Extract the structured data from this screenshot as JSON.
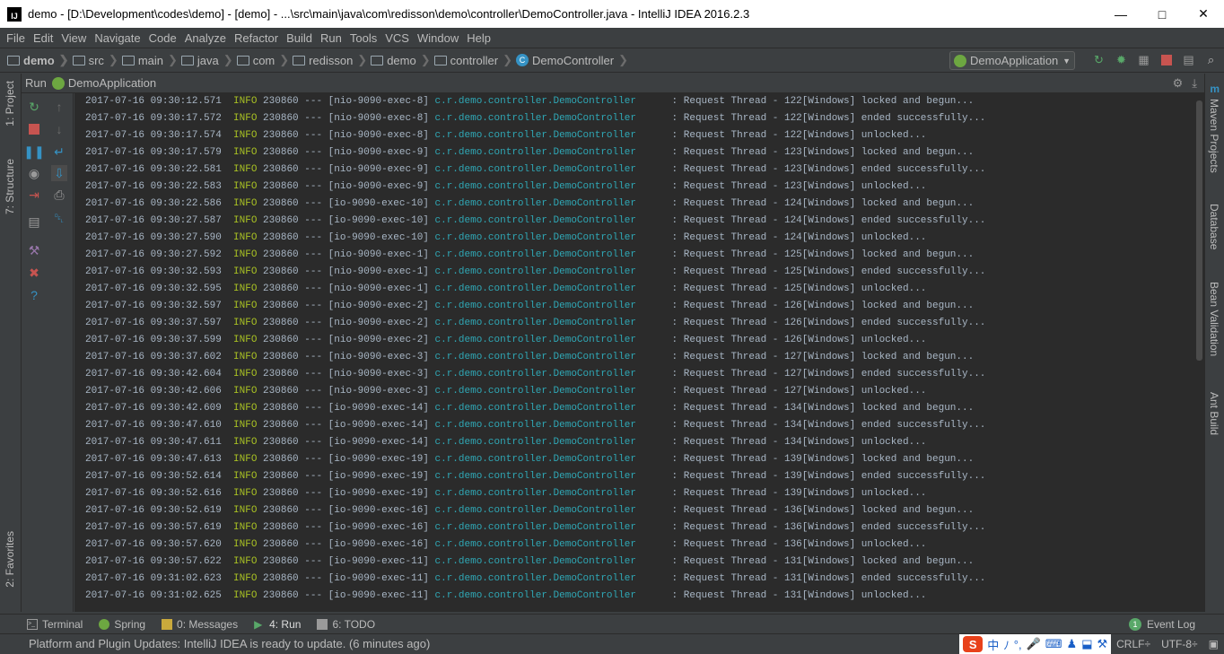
{
  "window": {
    "title": "demo - [D:\\Development\\codes\\demo] - [demo] - ...\\src\\main\\java\\com\\redisson\\demo\\controller\\DemoController.java - IntelliJ IDEA 2016.2.3",
    "logo": "IJ"
  },
  "menu": [
    "File",
    "Edit",
    "View",
    "Navigate",
    "Code",
    "Analyze",
    "Refactor",
    "Build",
    "Run",
    "Tools",
    "VCS",
    "Window",
    "Help"
  ],
  "breadcrumb": [
    "demo",
    "src",
    "main",
    "java",
    "com",
    "redisson",
    "demo",
    "controller",
    "DemoController"
  ],
  "run_config": "DemoApplication",
  "run_panel": {
    "label": "Run",
    "config": "DemoApplication"
  },
  "left_tabs": {
    "project": "1: Project",
    "structure": "7: Structure",
    "favorites": "2: Favorites"
  },
  "right_tabs": {
    "maven": "Maven Projects",
    "database": "Database",
    "bean": "Bean Validation",
    "ant": "Ant Build"
  },
  "log_lines": [
    {
      "time": "2017-07-16 09:30:12.571",
      "level": "INFO",
      "pid": "230860",
      "thread": "[nio-9090-exec-8]",
      "logger": "c.r.demo.controller.DemoController",
      "msg": ": Request Thread - 122[Windows] locked and begun..."
    },
    {
      "time": "2017-07-16 09:30:17.572",
      "level": "INFO",
      "pid": "230860",
      "thread": "[nio-9090-exec-8]",
      "logger": "c.r.demo.controller.DemoController",
      "msg": ": Request Thread - 122[Windows] ended successfully..."
    },
    {
      "time": "2017-07-16 09:30:17.574",
      "level": "INFO",
      "pid": "230860",
      "thread": "[nio-9090-exec-8]",
      "logger": "c.r.demo.controller.DemoController",
      "msg": ": Request Thread - 122[Windows] unlocked..."
    },
    {
      "time": "2017-07-16 09:30:17.579",
      "level": "INFO",
      "pid": "230860",
      "thread": "[nio-9090-exec-9]",
      "logger": "c.r.demo.controller.DemoController",
      "msg": ": Request Thread - 123[Windows] locked and begun..."
    },
    {
      "time": "2017-07-16 09:30:22.581",
      "level": "INFO",
      "pid": "230860",
      "thread": "[nio-9090-exec-9]",
      "logger": "c.r.demo.controller.DemoController",
      "msg": ": Request Thread - 123[Windows] ended successfully..."
    },
    {
      "time": "2017-07-16 09:30:22.583",
      "level": "INFO",
      "pid": "230860",
      "thread": "[nio-9090-exec-9]",
      "logger": "c.r.demo.controller.DemoController",
      "msg": ": Request Thread - 123[Windows] unlocked..."
    },
    {
      "time": "2017-07-16 09:30:22.586",
      "level": "INFO",
      "pid": "230860",
      "thread": "[io-9090-exec-10]",
      "logger": "c.r.demo.controller.DemoController",
      "msg": ": Request Thread - 124[Windows] locked and begun..."
    },
    {
      "time": "2017-07-16 09:30:27.587",
      "level": "INFO",
      "pid": "230860",
      "thread": "[io-9090-exec-10]",
      "logger": "c.r.demo.controller.DemoController",
      "msg": ": Request Thread - 124[Windows] ended successfully..."
    },
    {
      "time": "2017-07-16 09:30:27.590",
      "level": "INFO",
      "pid": "230860",
      "thread": "[io-9090-exec-10]",
      "logger": "c.r.demo.controller.DemoController",
      "msg": ": Request Thread - 124[Windows] unlocked..."
    },
    {
      "time": "2017-07-16 09:30:27.592",
      "level": "INFO",
      "pid": "230860",
      "thread": "[nio-9090-exec-1]",
      "logger": "c.r.demo.controller.DemoController",
      "msg": ": Request Thread - 125[Windows] locked and begun..."
    },
    {
      "time": "2017-07-16 09:30:32.593",
      "level": "INFO",
      "pid": "230860",
      "thread": "[nio-9090-exec-1]",
      "logger": "c.r.demo.controller.DemoController",
      "msg": ": Request Thread - 125[Windows] ended successfully..."
    },
    {
      "time": "2017-07-16 09:30:32.595",
      "level": "INFO",
      "pid": "230860",
      "thread": "[nio-9090-exec-1]",
      "logger": "c.r.demo.controller.DemoController",
      "msg": ": Request Thread - 125[Windows] unlocked..."
    },
    {
      "time": "2017-07-16 09:30:32.597",
      "level": "INFO",
      "pid": "230860",
      "thread": "[nio-9090-exec-2]",
      "logger": "c.r.demo.controller.DemoController",
      "msg": ": Request Thread - 126[Windows] locked and begun..."
    },
    {
      "time": "2017-07-16 09:30:37.597",
      "level": "INFO",
      "pid": "230860",
      "thread": "[nio-9090-exec-2]",
      "logger": "c.r.demo.controller.DemoController",
      "msg": ": Request Thread - 126[Windows] ended successfully..."
    },
    {
      "time": "2017-07-16 09:30:37.599",
      "level": "INFO",
      "pid": "230860",
      "thread": "[nio-9090-exec-2]",
      "logger": "c.r.demo.controller.DemoController",
      "msg": ": Request Thread - 126[Windows] unlocked..."
    },
    {
      "time": "2017-07-16 09:30:37.602",
      "level": "INFO",
      "pid": "230860",
      "thread": "[nio-9090-exec-3]",
      "logger": "c.r.demo.controller.DemoController",
      "msg": ": Request Thread - 127[Windows] locked and begun..."
    },
    {
      "time": "2017-07-16 09:30:42.604",
      "level": "INFO",
      "pid": "230860",
      "thread": "[nio-9090-exec-3]",
      "logger": "c.r.demo.controller.DemoController",
      "msg": ": Request Thread - 127[Windows] ended successfully..."
    },
    {
      "time": "2017-07-16 09:30:42.606",
      "level": "INFO",
      "pid": "230860",
      "thread": "[nio-9090-exec-3]",
      "logger": "c.r.demo.controller.DemoController",
      "msg": ": Request Thread - 127[Windows] unlocked..."
    },
    {
      "time": "2017-07-16 09:30:42.609",
      "level": "INFO",
      "pid": "230860",
      "thread": "[io-9090-exec-14]",
      "logger": "c.r.demo.controller.DemoController",
      "msg": ": Request Thread - 134[Windows] locked and begun..."
    },
    {
      "time": "2017-07-16 09:30:47.610",
      "level": "INFO",
      "pid": "230860",
      "thread": "[io-9090-exec-14]",
      "logger": "c.r.demo.controller.DemoController",
      "msg": ": Request Thread - 134[Windows] ended successfully..."
    },
    {
      "time": "2017-07-16 09:30:47.611",
      "level": "INFO",
      "pid": "230860",
      "thread": "[io-9090-exec-14]",
      "logger": "c.r.demo.controller.DemoController",
      "msg": ": Request Thread - 134[Windows] unlocked..."
    },
    {
      "time": "2017-07-16 09:30:47.613",
      "level": "INFO",
      "pid": "230860",
      "thread": "[io-9090-exec-19]",
      "logger": "c.r.demo.controller.DemoController",
      "msg": ": Request Thread - 139[Windows] locked and begun..."
    },
    {
      "time": "2017-07-16 09:30:52.614",
      "level": "INFO",
      "pid": "230860",
      "thread": "[io-9090-exec-19]",
      "logger": "c.r.demo.controller.DemoController",
      "msg": ": Request Thread - 139[Windows] ended successfully..."
    },
    {
      "time": "2017-07-16 09:30:52.616",
      "level": "INFO",
      "pid": "230860",
      "thread": "[io-9090-exec-19]",
      "logger": "c.r.demo.controller.DemoController",
      "msg": ": Request Thread - 139[Windows] unlocked..."
    },
    {
      "time": "2017-07-16 09:30:52.619",
      "level": "INFO",
      "pid": "230860",
      "thread": "[io-9090-exec-16]",
      "logger": "c.r.demo.controller.DemoController",
      "msg": ": Request Thread - 136[Windows] locked and begun..."
    },
    {
      "time": "2017-07-16 09:30:57.619",
      "level": "INFO",
      "pid": "230860",
      "thread": "[io-9090-exec-16]",
      "logger": "c.r.demo.controller.DemoController",
      "msg": ": Request Thread - 136[Windows] ended successfully..."
    },
    {
      "time": "2017-07-16 09:30:57.620",
      "level": "INFO",
      "pid": "230860",
      "thread": "[io-9090-exec-16]",
      "logger": "c.r.demo.controller.DemoController",
      "msg": ": Request Thread - 136[Windows] unlocked..."
    },
    {
      "time": "2017-07-16 09:30:57.622",
      "level": "INFO",
      "pid": "230860",
      "thread": "[io-9090-exec-11]",
      "logger": "c.r.demo.controller.DemoController",
      "msg": ": Request Thread - 131[Windows] locked and begun..."
    },
    {
      "time": "2017-07-16 09:31:02.623",
      "level": "INFO",
      "pid": "230860",
      "thread": "[io-9090-exec-11]",
      "logger": "c.r.demo.controller.DemoController",
      "msg": ": Request Thread - 131[Windows] ended successfully..."
    },
    {
      "time": "2017-07-16 09:31:02.625",
      "level": "INFO",
      "pid": "230860",
      "thread": "[io-9090-exec-11]",
      "logger": "c.r.demo.controller.DemoController",
      "msg": ": Request Thread - 131[Windows] unlocked..."
    }
  ],
  "bottom_tabs": [
    {
      "label": "Terminal",
      "icon": "terminal-icon"
    },
    {
      "label": "Spring",
      "icon": "spring-icon"
    },
    {
      "label": "0: Messages",
      "icon": "messages-icon"
    },
    {
      "label": "4: Run",
      "icon": "run-icon",
      "active": true
    },
    {
      "label": "6: TODO",
      "icon": "todo-icon"
    }
  ],
  "event_log": {
    "label": "Event Log",
    "count": "1"
  },
  "status": {
    "message": "Platform and Plugin Updates: IntelliJ IDEA is ready to update. (6 minutes ago)",
    "line_sep": "CRLF÷",
    "encoding": "UTF-8÷",
    "ime_chars": [
      "中",
      "ﾉ",
      "°,"
    ]
  },
  "colors": {
    "bg": "#2b2b2b",
    "panel": "#3c3f41",
    "info": "#a8c023",
    "logger": "#2fa7b5",
    "text": "#a9b7c6"
  }
}
